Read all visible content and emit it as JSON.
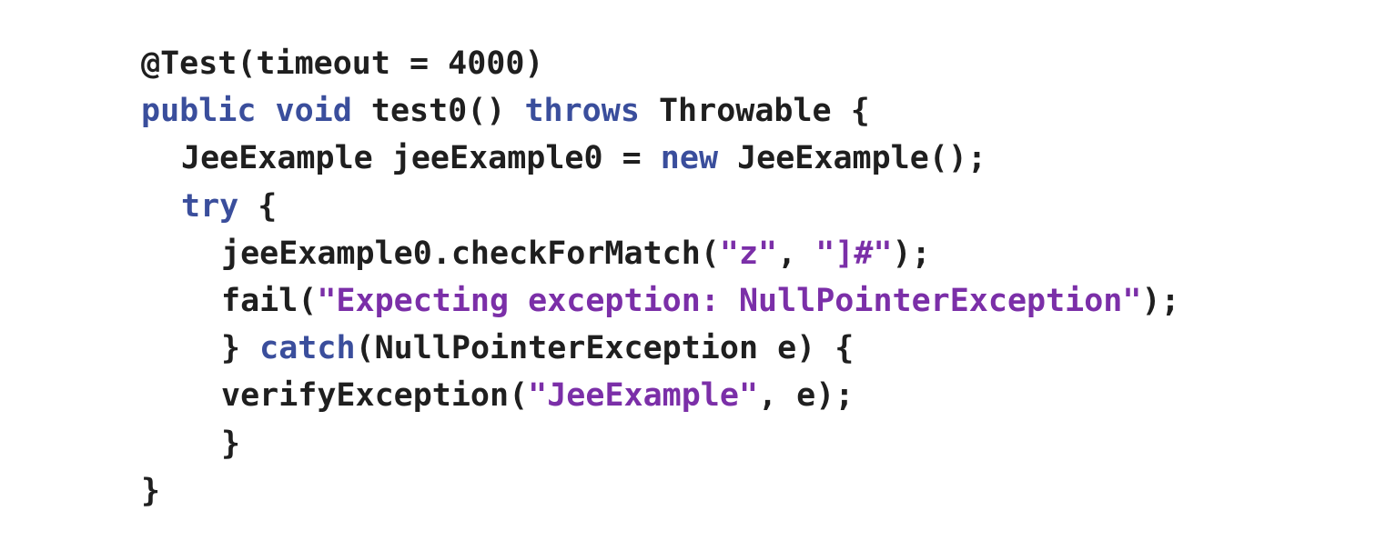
{
  "colors": {
    "background": "#ffffff",
    "plain": "#1f1f1f",
    "keyword": "#3a4e9c",
    "string": "#7b2fa8"
  },
  "code": {
    "lines": [
      {
        "indent": 0,
        "tokens": [
          {
            "t": "plain",
            "v": "@Test(timeout = 4000)"
          }
        ]
      },
      {
        "indent": 0,
        "tokens": [
          {
            "t": "keyword",
            "v": "public"
          },
          {
            "t": "plain",
            "v": " "
          },
          {
            "t": "keyword",
            "v": "void"
          },
          {
            "t": "plain",
            "v": " test0() "
          },
          {
            "t": "keyword",
            "v": "throws"
          },
          {
            "t": "plain",
            "v": " Throwable {"
          }
        ]
      },
      {
        "indent": 1,
        "tokens": [
          {
            "t": "plain",
            "v": "JeeExample jeeExample0 = "
          },
          {
            "t": "keyword",
            "v": "new"
          },
          {
            "t": "plain",
            "v": " JeeExample();"
          }
        ]
      },
      {
        "indent": 1,
        "tokens": [
          {
            "t": "keyword",
            "v": "try"
          },
          {
            "t": "plain",
            "v": " {"
          }
        ]
      },
      {
        "indent": 2,
        "tokens": [
          {
            "t": "plain",
            "v": "jeeExample0.checkForMatch("
          },
          {
            "t": "string",
            "v": "\"z\""
          },
          {
            "t": "plain",
            "v": ", "
          },
          {
            "t": "string",
            "v": "\"]#\""
          },
          {
            "t": "plain",
            "v": ");"
          }
        ]
      },
      {
        "indent": 2,
        "tokens": [
          {
            "t": "plain",
            "v": "fail("
          },
          {
            "t": "string",
            "v": "\"Expecting exception: NullPointerException\""
          },
          {
            "t": "plain",
            "v": ");"
          }
        ]
      },
      {
        "indent": 2,
        "tokens": [
          {
            "t": "plain",
            "v": "} "
          },
          {
            "t": "keyword",
            "v": "catch"
          },
          {
            "t": "plain",
            "v": "(NullPointerException e) {"
          }
        ]
      },
      {
        "indent": 2,
        "tokens": [
          {
            "t": "plain",
            "v": "verifyException("
          },
          {
            "t": "string",
            "v": "\"JeeExample\""
          },
          {
            "t": "plain",
            "v": ", e);"
          }
        ]
      },
      {
        "indent": 2,
        "tokens": [
          {
            "t": "plain",
            "v": "}"
          }
        ]
      },
      {
        "indent": 0,
        "tokens": [
          {
            "t": "plain",
            "v": "}"
          }
        ]
      }
    ]
  }
}
